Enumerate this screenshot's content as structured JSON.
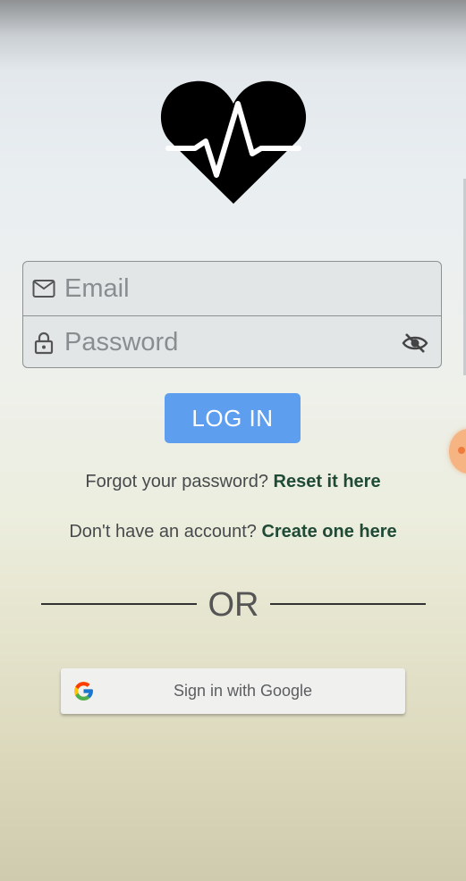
{
  "logo": {
    "icon": "heart-pulse-icon"
  },
  "login_form": {
    "email": {
      "placeholder": "Email",
      "value": "",
      "icon": "mail-icon"
    },
    "password": {
      "placeholder": "Password",
      "value": "",
      "icon": "lock-icon",
      "toggle_icon": "eye-off-icon"
    }
  },
  "login_button": {
    "label": "LOG IN",
    "color": "#5d9fee"
  },
  "forgot": {
    "prompt": "Forgot your password?",
    "link": "Reset it here"
  },
  "signup": {
    "prompt": "Don't have an account?",
    "link": "Create one here"
  },
  "divider": {
    "label": "OR"
  },
  "google_button": {
    "label": "Sign in with Google",
    "icon": "google-icon"
  },
  "colors": {
    "link": "#1f4a36",
    "accent": "#5d9fee"
  }
}
